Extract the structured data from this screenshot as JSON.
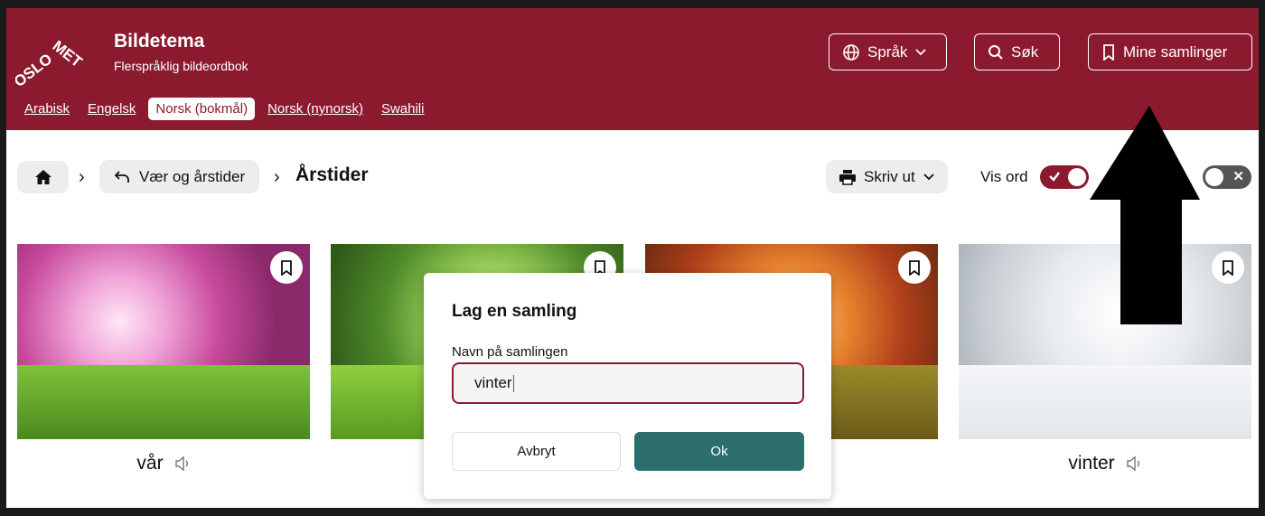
{
  "header": {
    "logo_text": "OSLOMET",
    "title": "Bildetema",
    "subtitle": "Flerspråklig bildeordbok",
    "language_button": "Språk",
    "search_button": "Søk",
    "collections_button": "Mine samlinger",
    "brand_color": "#8b1a2f"
  },
  "languages": [
    "Arabisk",
    "Engelsk",
    "Norsk (bokmål)",
    "Norsk (nynorsk)",
    "Swahili"
  ],
  "active_language": "Norsk (bokmål)",
  "breadcrumb": {
    "parent": "Vær og årstider",
    "current": "Årstider"
  },
  "toolbar": {
    "print_label": "Skriv ut",
    "show_words_label": "Vis ord",
    "show_words_on": true,
    "second_toggle_on": false
  },
  "cards": [
    {
      "word": "vår",
      "image": "spring-cherry-trees"
    },
    {
      "word": "",
      "image": "summer-green-trees"
    },
    {
      "word": "",
      "image": "autumn-orange-trees"
    },
    {
      "word": "vinter",
      "image": "winter-snowy-trees"
    }
  ],
  "dialog": {
    "title": "Lag en samling",
    "field_label": "Navn på samlingen",
    "field_value": "vinter",
    "cancel_label": "Avbryt",
    "ok_label": "Ok",
    "ok_color": "#2b6e6b"
  }
}
